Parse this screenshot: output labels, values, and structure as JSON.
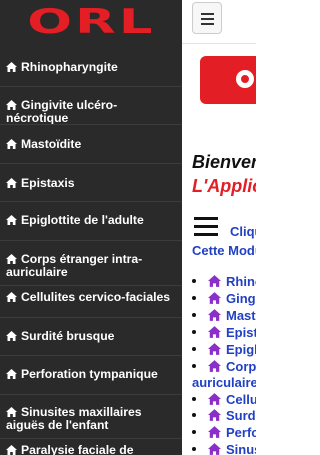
{
  "sidebar": {
    "brand": "ORL",
    "items": [
      {
        "label": "Rhinopharyngite",
        "icon": "home-icon"
      },
      {
        "label": "Gingivite ulcéro-nécrotique",
        "icon": "home-icon"
      },
      {
        "label": "Mastoïdite",
        "icon": "home-icon"
      },
      {
        "label": "Epistaxis",
        "icon": "home-icon"
      },
      {
        "label": "Epiglottite de l'adulte",
        "icon": "home-icon"
      },
      {
        "label": "Corps étranger intra-auriculaire",
        "icon": "home-icon"
      },
      {
        "label": "Cellulites cervico-faciales",
        "icon": "home-icon"
      },
      {
        "label": "Surdité brusque",
        "icon": "home-icon"
      },
      {
        "label": "Perforation tympanique",
        "icon": "home-icon"
      },
      {
        "label": "Sinusites maxillaires aiguës de l'enfant",
        "icon": "home-icon"
      },
      {
        "label": "Paralysie faciale de l'enfant",
        "icon": "home-icon"
      }
    ]
  },
  "main": {
    "menu_button_icon": "hamburger-icon",
    "welcome": "Bienvenue",
    "app_title": "L'Application",
    "click_text": "Cliquez",
    "module_text": "Cette Module",
    "list": [
      "Rhinopharyngite",
      "Gingivite ulcéro-nécrotique",
      "Mastoïdite",
      "Epistaxis",
      "Epiglottite de l'adulte",
      "Corps étranger intra-",
      "auriculaire",
      "Cellulites cervico-faciales",
      "Surdité brusque",
      "Perforation tympanique",
      "Sinusites maxillaires aiguës"
    ]
  },
  "colors": {
    "sidebar_bg": "#2a2a2a",
    "brand_red": "#e31e24",
    "link_blue": "#2140c4",
    "icon_purple": "#8b2fc9"
  }
}
